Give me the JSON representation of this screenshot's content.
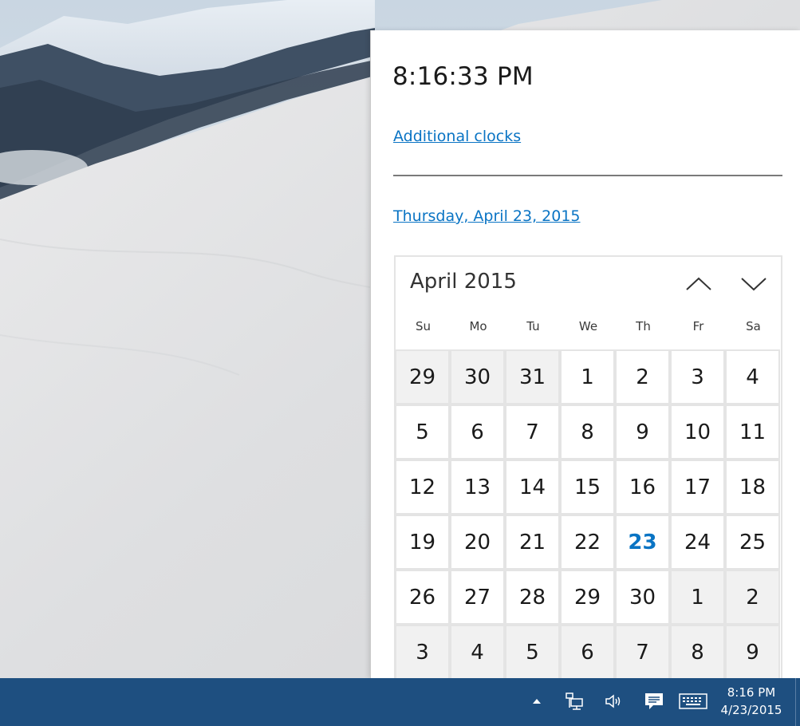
{
  "flyout": {
    "time": "8:16:33 PM",
    "additional_clocks_label": "Additional clocks",
    "date_label": "Thursday, April 23, 2015"
  },
  "calendar": {
    "month_label": "April 2015",
    "weekdays": [
      "Su",
      "Mo",
      "Tu",
      "We",
      "Th",
      "Fr",
      "Sa"
    ],
    "today": "23",
    "weeks": [
      [
        {
          "d": "29",
          "other": true
        },
        {
          "d": "30",
          "other": true
        },
        {
          "d": "31",
          "other": true
        },
        {
          "d": "1"
        },
        {
          "d": "2"
        },
        {
          "d": "3"
        },
        {
          "d": "4"
        }
      ],
      [
        {
          "d": "5"
        },
        {
          "d": "6"
        },
        {
          "d": "7"
        },
        {
          "d": "8"
        },
        {
          "d": "9"
        },
        {
          "d": "10"
        },
        {
          "d": "11"
        }
      ],
      [
        {
          "d": "12"
        },
        {
          "d": "13"
        },
        {
          "d": "14"
        },
        {
          "d": "15"
        },
        {
          "d": "16"
        },
        {
          "d": "17"
        },
        {
          "d": "18"
        }
      ],
      [
        {
          "d": "19"
        },
        {
          "d": "20"
        },
        {
          "d": "21"
        },
        {
          "d": "22"
        },
        {
          "d": "23",
          "today": true
        },
        {
          "d": "24"
        },
        {
          "d": "25"
        }
      ],
      [
        {
          "d": "26"
        },
        {
          "d": "27"
        },
        {
          "d": "28"
        },
        {
          "d": "29"
        },
        {
          "d": "30"
        },
        {
          "d": "1",
          "other": true
        },
        {
          "d": "2",
          "other": true
        }
      ],
      [
        {
          "d": "3",
          "other": true
        },
        {
          "d": "4",
          "other": true
        },
        {
          "d": "5",
          "other": true
        },
        {
          "d": "6",
          "other": true
        },
        {
          "d": "7",
          "other": true
        },
        {
          "d": "8",
          "other": true
        },
        {
          "d": "9",
          "other": true
        }
      ]
    ],
    "icons": {
      "previous": "chevron-up-icon",
      "next": "chevron-down-icon"
    }
  },
  "taskbar": {
    "time": "8:16 PM",
    "date": "4/23/2015",
    "icons": [
      "chevron-up-icon",
      "network-icon",
      "volume-icon",
      "action-center-icon",
      "keyboard-icon"
    ]
  },
  "colors": {
    "accent": "#0a74c4",
    "taskbar": "#1e4f80",
    "flyout_bg": "#ffffff",
    "other_month_cell": "#f1f1f1"
  }
}
